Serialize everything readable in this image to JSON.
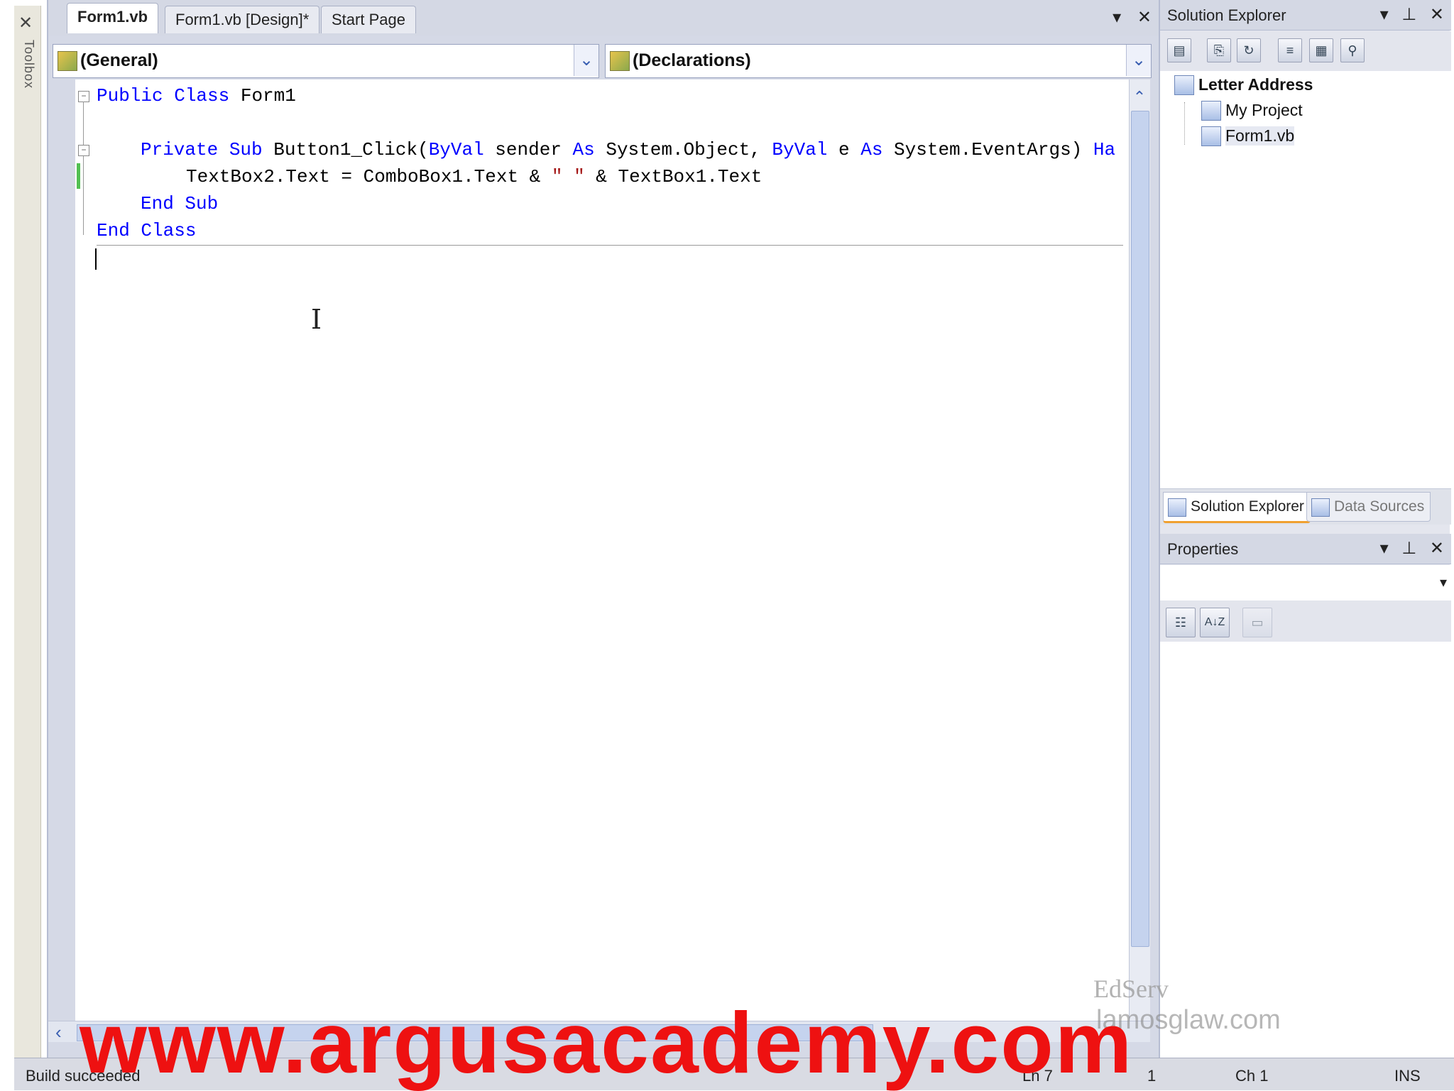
{
  "toolbox": {
    "label": "Toolbox"
  },
  "tabs": [
    {
      "label": "Form1.vb",
      "active": true
    },
    {
      "label": "Form1.vb [Design]*",
      "active": false
    },
    {
      "label": "Start Page",
      "active": false
    }
  ],
  "tab_actions": {
    "dropdown": "▾",
    "close": "✕"
  },
  "combos": {
    "left": "(General)",
    "right": "(Declarations)"
  },
  "code": {
    "line1_kw": "Public Class",
    "line1_rest": " Form1",
    "line3_kw1": "Private Sub",
    "line3_a": " Button1_Click(",
    "line3_kw2": "ByVal",
    "line3_b": " sender ",
    "line3_kw3": "As",
    "line3_c": " System.Object, ",
    "line3_kw4": "ByVal",
    "line3_d": " e ",
    "line3_kw5": "As",
    "line3_e": " System.EventArgs) ",
    "line3_kw6": "Ha",
    "line4_a": "TextBox2.Text = ComboBox1.Text & ",
    "line4_str": "\" \"",
    "line4_b": " & TextBox1.Text",
    "line5_kw": "End Sub",
    "line6_kw": "End Class"
  },
  "solution_explorer": {
    "title": "Solution Explorer",
    "project": "Letter Address",
    "items": [
      "My Project",
      "Form1.vb"
    ]
  },
  "panel_tabs": [
    "Solution Explorer",
    "Data Sources"
  ],
  "properties": {
    "title": "Properties",
    "sort_label": "A↓Z"
  },
  "status": {
    "message": "Build succeeded",
    "ln": "Ln 7",
    "col": "1",
    "ch": "Ch 1",
    "ins": "INS"
  },
  "watermark": {
    "main": "www.argusacademy.com",
    "brand": "EdServ",
    "site": "lamosglaw.com"
  }
}
